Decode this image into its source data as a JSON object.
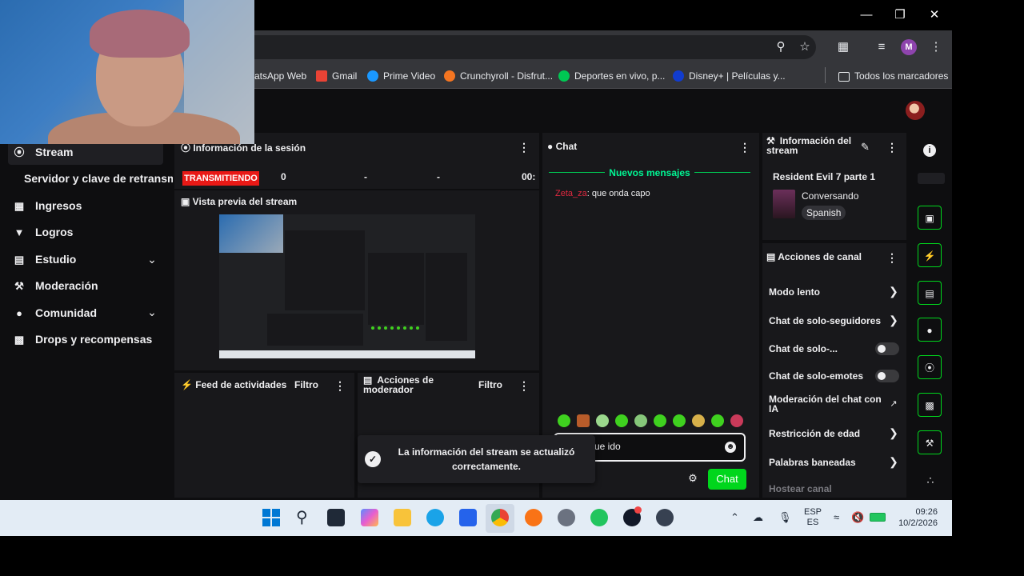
{
  "window": {
    "minimize": "—",
    "maximize": "❐",
    "close": "✕"
  },
  "browser": {
    "toolbar_icons": [
      "search-icon",
      "star-icon",
      "extensions-icon",
      "media-icon",
      "profile-icon",
      "menu-icon"
    ],
    "profile_initial": "M",
    "bookmarks": [
      {
        "label": "atsApp Web",
        "color": "#25d366"
      },
      {
        "label": "Gmail",
        "color": "#ea4335"
      },
      {
        "label": "Prime Video",
        "color": "#1a98ff"
      },
      {
        "label": "Crunchyroll - Disfrut...",
        "color": "#f47521"
      },
      {
        "label": "Deportes en vivo, p...",
        "color": "#00c853"
      },
      {
        "label": "Disney+ | Películas y...",
        "color": "#113ccf"
      }
    ],
    "all_bookmarks": "Todos los marcadores"
  },
  "sidebar": {
    "items": [
      {
        "label": "Stream",
        "icon": "live-icon",
        "active": true
      },
      {
        "label": "Servidor y clave de retransm",
        "icon": ""
      },
      {
        "label": "Ingresos",
        "icon": "chart-icon"
      },
      {
        "label": "Logros",
        "icon": "trophy-icon"
      },
      {
        "label": "Estudio",
        "icon": "studio-icon",
        "expandable": true
      },
      {
        "label": "Moderación",
        "icon": "wrench-icon"
      },
      {
        "label": "Comunidad",
        "icon": "community-icon",
        "expandable": true
      },
      {
        "label": "Drops y recompensas",
        "icon": "drops-icon"
      }
    ]
  },
  "session": {
    "title": "Información de la sesión",
    "status": "TRANSMITIENDO",
    "viewers": "0",
    "stat2": "-",
    "stat3": "-",
    "time": "00:"
  },
  "preview": {
    "title": "Vista previa del stream"
  },
  "activity": {
    "title": "Feed de actividades",
    "filter": "Filtro"
  },
  "mod_actions": {
    "title": "Acciones de moderador",
    "filter": "Filtro"
  },
  "chat": {
    "title": "Chat",
    "new_messages": "Nuevos mensajes",
    "messages": [
      {
        "user": "Zeta_za",
        "user_color": "#e0283f",
        "text": ": que onda capo"
      }
    ],
    "input_value": "ue ido",
    "send": "Chat"
  },
  "toast": {
    "text": "La información del stream se actualizó correctamente."
  },
  "stream_info": {
    "title": "Información del stream",
    "stream_title": "Resident Evil 7 parte 1",
    "category": "Conversando",
    "tag": "Spanish"
  },
  "channel_actions": {
    "title": "Acciones de canal",
    "items": [
      {
        "label": "Modo lento",
        "control": "arrow"
      },
      {
        "label": "Chat de solo-seguidores",
        "control": "arrow"
      },
      {
        "label": "Chat de solo-...",
        "control": "toggle"
      },
      {
        "label": "Chat de solo-emotes",
        "control": "toggle"
      },
      {
        "label": "Moderación del chat con IA",
        "control": "external"
      },
      {
        "label": "Restricción de edad",
        "control": "arrow"
      },
      {
        "label": "Palabras baneadas",
        "control": "arrow"
      },
      {
        "label": "Hostear canal",
        "control": "none"
      }
    ]
  },
  "quick_actions": [
    "info-icon",
    "clip-icon",
    "lightning-icon",
    "notes-icon",
    "chat-icon",
    "broadcast-icon",
    "layout-icon",
    "wrench-icon",
    "more-icon"
  ],
  "taskbar": {
    "lang_top": "ESP",
    "lang_bottom": "ES",
    "time": "09:26",
    "date": "10/2/2026"
  }
}
